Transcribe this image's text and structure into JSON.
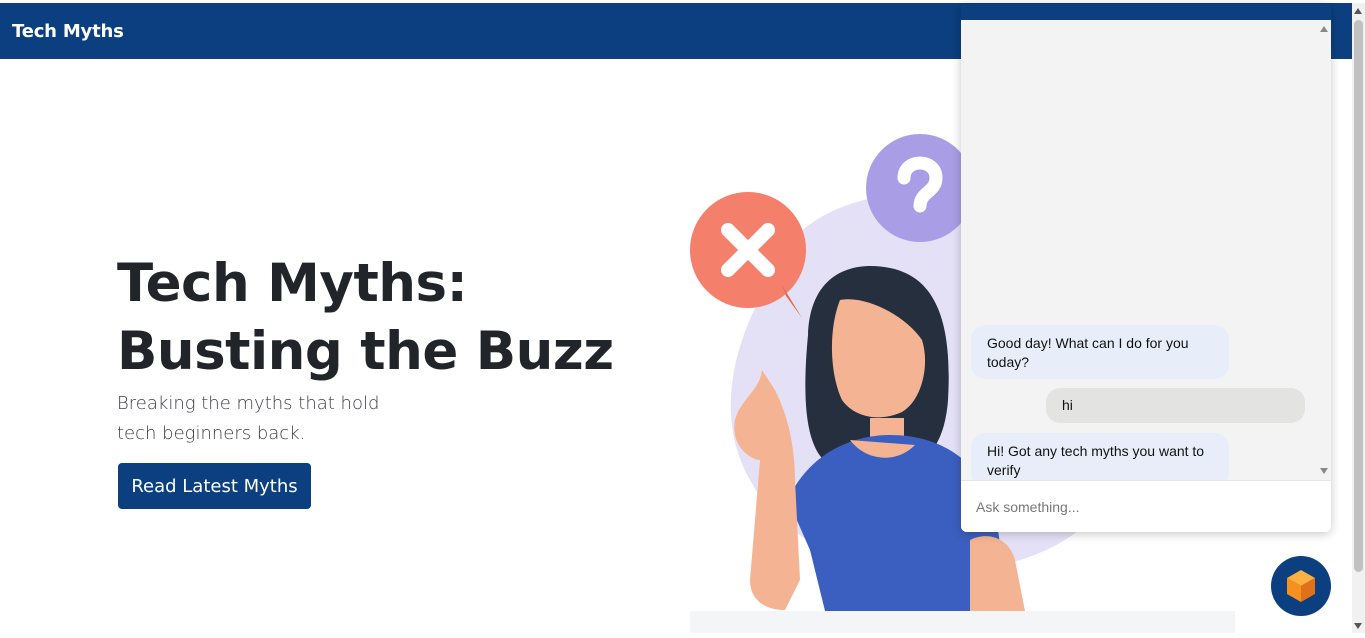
{
  "navbar": {
    "brand": "Tech Myths"
  },
  "hero": {
    "title_line1": "Tech Myths:",
    "title_line2": "Busting the Buzz",
    "subtitle": "Breaking the myths that hold tech beginners back.",
    "cta_label": "Read Latest Myths"
  },
  "illustration": {
    "icons": [
      "x-mark-bubble-icon",
      "question-mark-bubble-icon"
    ],
    "colors": {
      "x_bubble": "#f47f6b",
      "question_bubble": "#a99de6",
      "backdrop": "#e4e1f7",
      "shirt": "#3b5fc0",
      "hair": "#252f3e",
      "skin": "#f4b493"
    }
  },
  "chat": {
    "messages": [
      {
        "from": "bot",
        "text": "Good day! What can I do for you today?"
      },
      {
        "from": "user",
        "text": "hi"
      },
      {
        "from": "bot",
        "text": "Hi! Got any tech myths you want to verify"
      }
    ],
    "input_placeholder": "Ask something...",
    "launcher_icon": "cube-icon"
  },
  "colors": {
    "primary": "#0b3f7f",
    "bot_bubble": "#e8eef9",
    "user_bubble": "#e3e4e2",
    "accent_orange": "#f7901e"
  }
}
